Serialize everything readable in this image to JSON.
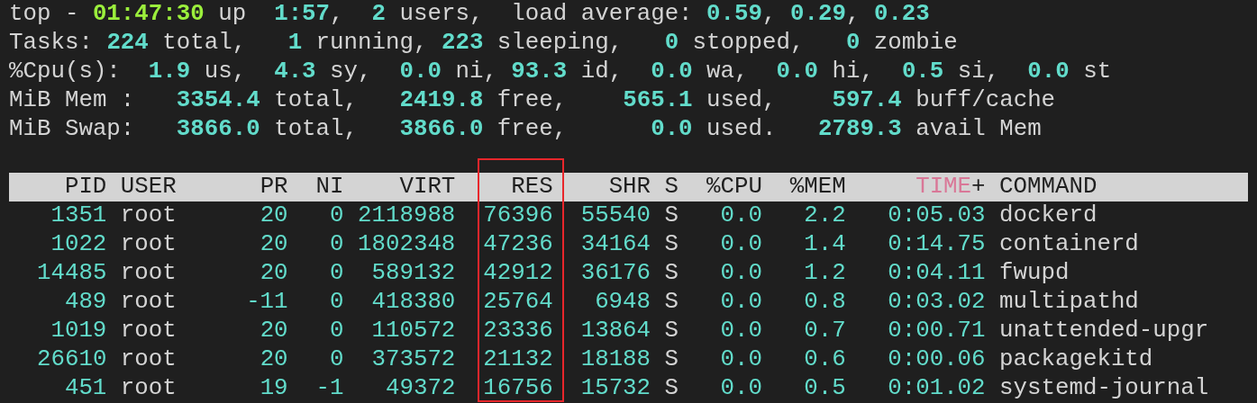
{
  "summary": [
    {
      "segments": [
        {
          "kind": "label",
          "text": "top - "
        },
        {
          "kind": "clock",
          "text": "01:47:30"
        },
        {
          "kind": "label",
          "text": " up  "
        },
        {
          "kind": "value",
          "text": "1:57"
        },
        {
          "kind": "label",
          "text": ",  "
        },
        {
          "kind": "value",
          "text": "2"
        },
        {
          "kind": "label",
          "text": " users,  load average: "
        },
        {
          "kind": "value",
          "text": "0.59"
        },
        {
          "kind": "label",
          "text": ", "
        },
        {
          "kind": "value",
          "text": "0.29"
        },
        {
          "kind": "label",
          "text": ", "
        },
        {
          "kind": "value",
          "text": "0.23"
        }
      ]
    },
    {
      "segments": [
        {
          "kind": "label",
          "text": "Tasks: "
        },
        {
          "kind": "value",
          "text": "224"
        },
        {
          "kind": "label",
          "text": " total,   "
        },
        {
          "kind": "value",
          "text": "1"
        },
        {
          "kind": "label",
          "text": " running, "
        },
        {
          "kind": "value",
          "text": "223"
        },
        {
          "kind": "label",
          "text": " sleeping,   "
        },
        {
          "kind": "value",
          "text": "0"
        },
        {
          "kind": "label",
          "text": " stopped,   "
        },
        {
          "kind": "value",
          "text": "0"
        },
        {
          "kind": "label",
          "text": " zombie"
        }
      ]
    },
    {
      "segments": [
        {
          "kind": "label",
          "text": "%Cpu(s):  "
        },
        {
          "kind": "value",
          "text": "1.9"
        },
        {
          "kind": "label",
          "text": " us,  "
        },
        {
          "kind": "value",
          "text": "4.3"
        },
        {
          "kind": "label",
          "text": " sy,  "
        },
        {
          "kind": "value",
          "text": "0.0"
        },
        {
          "kind": "label",
          "text": " ni, "
        },
        {
          "kind": "value",
          "text": "93.3"
        },
        {
          "kind": "label",
          "text": " id,  "
        },
        {
          "kind": "value",
          "text": "0.0"
        },
        {
          "kind": "label",
          "text": " wa,  "
        },
        {
          "kind": "value",
          "text": "0.0"
        },
        {
          "kind": "label",
          "text": " hi,  "
        },
        {
          "kind": "value",
          "text": "0.5"
        },
        {
          "kind": "label",
          "text": " si,  "
        },
        {
          "kind": "value",
          "text": "0.0"
        },
        {
          "kind": "label",
          "text": " st"
        }
      ]
    },
    {
      "segments": [
        {
          "kind": "label",
          "text": "MiB Mem :   "
        },
        {
          "kind": "value",
          "text": "3354.4"
        },
        {
          "kind": "label",
          "text": " total,   "
        },
        {
          "kind": "value",
          "text": "2419.8"
        },
        {
          "kind": "label",
          "text": " free,    "
        },
        {
          "kind": "value",
          "text": "565.1"
        },
        {
          "kind": "label",
          "text": " used,    "
        },
        {
          "kind": "value",
          "text": "597.4"
        },
        {
          "kind": "label",
          "text": " buff/cache"
        }
      ]
    },
    {
      "segments": [
        {
          "kind": "label",
          "text": "MiB Swap:   "
        },
        {
          "kind": "value",
          "text": "3866.0"
        },
        {
          "kind": "label",
          "text": " total,   "
        },
        {
          "kind": "value",
          "text": "3866.0"
        },
        {
          "kind": "label",
          "text": " free,      "
        },
        {
          "kind": "value",
          "text": "0.0"
        },
        {
          "kind": "label",
          "text": " used.   "
        },
        {
          "kind": "value",
          "text": "2789.3"
        },
        {
          "kind": "label",
          "text": " avail Mem"
        }
      ]
    }
  ],
  "table": {
    "columns": [
      {
        "label": "PID",
        "kind": "number",
        "sorted": false,
        "highlighted": false
      },
      {
        "label": "USER",
        "kind": "text",
        "sorted": false,
        "highlighted": false
      },
      {
        "label": "PR",
        "kind": "number",
        "sorted": false,
        "highlighted": false
      },
      {
        "label": "NI",
        "kind": "number",
        "sorted": false,
        "highlighted": false
      },
      {
        "label": "VIRT",
        "kind": "number",
        "sorted": false,
        "highlighted": false
      },
      {
        "label": "RES",
        "kind": "number",
        "sorted": false,
        "highlighted": true
      },
      {
        "label": "SHR",
        "kind": "number",
        "sorted": false,
        "highlighted": false
      },
      {
        "label": "S",
        "kind": "text",
        "sorted": false,
        "highlighted": false
      },
      {
        "label": "%CPU",
        "kind": "number",
        "sorted": false,
        "highlighted": false
      },
      {
        "label": "%MEM",
        "kind": "number",
        "sorted": false,
        "highlighted": false
      },
      {
        "label": "TIME",
        "suffix": "+",
        "kind": "number",
        "sorted": true,
        "highlighted": false
      },
      {
        "label": "COMMAND",
        "kind": "text",
        "sorted": false,
        "highlighted": false
      }
    ],
    "rows": [
      [
        "1351",
        "root",
        "20",
        "0",
        "2118988",
        "76396",
        "55540",
        "S",
        "0.0",
        "2.2",
        "0:05.03",
        "dockerd"
      ],
      [
        "1022",
        "root",
        "20",
        "0",
        "1802348",
        "47236",
        "34164",
        "S",
        "0.0",
        "1.4",
        "0:14.75",
        "containerd"
      ],
      [
        "14485",
        "root",
        "20",
        "0",
        "589132",
        "42912",
        "36176",
        "S",
        "0.0",
        "1.2",
        "0:04.11",
        "fwupd"
      ],
      [
        "489",
        "root",
        "-11",
        "0",
        "418380",
        "25764",
        "6948",
        "S",
        "0.0",
        "0.8",
        "0:03.02",
        "multipathd"
      ],
      [
        "1019",
        "root",
        "20",
        "0",
        "110572",
        "23336",
        "13864",
        "S",
        "0.0",
        "0.7",
        "0:00.71",
        "unattended-upgr"
      ],
      [
        "26610",
        "root",
        "20",
        "0",
        "373572",
        "21132",
        "18188",
        "S",
        "0.0",
        "0.6",
        "0:00.06",
        "packagekitd"
      ],
      [
        "451",
        "root",
        "19",
        "-1",
        "49372",
        "16756",
        "15732",
        "S",
        "0.0",
        "0.5",
        "0:01.02",
        "systemd-journal"
      ]
    ]
  }
}
